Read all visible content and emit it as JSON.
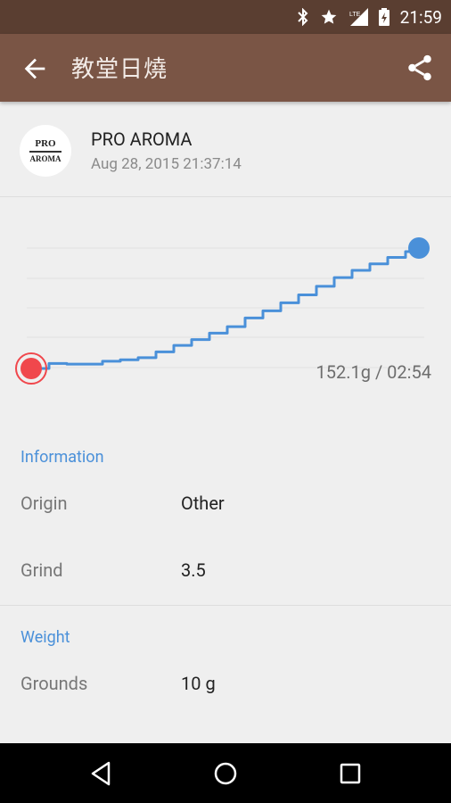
{
  "status_bar": {
    "time": "21:59",
    "icons": [
      "bluetooth-icon",
      "star-icon",
      "lte-signal-icon",
      "battery-charging-icon"
    ]
  },
  "app_bar": {
    "title": "教堂日燒",
    "back_icon": "arrow-back-icon",
    "share_icon": "share-icon"
  },
  "roast": {
    "avatar_text_top": "PRO",
    "avatar_text_bottom": "AROMA",
    "brand": "PRO AROMA",
    "datetime": "Aug 28, 2015 21:37:14"
  },
  "chart_data": {
    "type": "line",
    "summary_label": "152.1g / 02:54",
    "start_marker_color": "#f0474c",
    "end_marker_color": "#4a90d9",
    "series": [
      {
        "color": "#4a90d9",
        "x": [
          0,
          8,
          16,
          24,
          32,
          40,
          48,
          56,
          64,
          72,
          80,
          88,
          96,
          104,
          112,
          120,
          128,
          136,
          144,
          152,
          160,
          168,
          174
        ],
        "y": [
          0,
          7,
          6,
          6,
          10,
          12,
          15,
          23,
          32,
          40,
          49,
          58,
          70,
          80,
          91,
          102,
          114,
          126,
          136,
          145,
          154,
          162,
          167
        ]
      }
    ]
  },
  "information": {
    "heading": "Information",
    "rows": [
      {
        "label": "Origin",
        "value": "Other"
      },
      {
        "label": "Grind",
        "value": "3.5"
      }
    ]
  },
  "weight": {
    "heading": "Weight",
    "rows": [
      {
        "label": "Grounds",
        "value": "10 g"
      }
    ]
  },
  "nav_bar": {
    "icons": [
      "back-triangle-icon",
      "home-circle-icon",
      "recents-square-icon"
    ]
  }
}
